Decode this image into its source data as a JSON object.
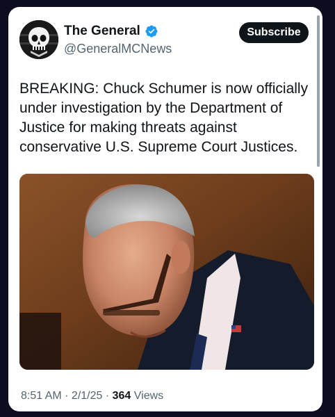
{
  "author": {
    "display_name": "The General",
    "handle": "@GeneralMCNews",
    "avatar_icon": "punisher-skull-avatar",
    "verified_icon": "verified-badge-icon",
    "verified_color": "#1d9bf0"
  },
  "actions": {
    "subscribe_label": "Subscribe"
  },
  "tweet": {
    "text_lines": [
      "BREAKING: Chuck Schumer is now officially",
      "under investigation by the Department of",
      "Justice for making threats against",
      "conservative U.S. Supreme Court Justices."
    ]
  },
  "meta": {
    "time": "8:51 AM",
    "separator": " · ",
    "date": "2/1/25",
    "views_count": "364",
    "views_label": " Views"
  },
  "colors": {
    "card_background": "#ffffff",
    "page_background": "#0d0d1f",
    "text_primary": "#0f1419",
    "text_secondary": "#536471",
    "subscribe_background": "#0f1419"
  }
}
